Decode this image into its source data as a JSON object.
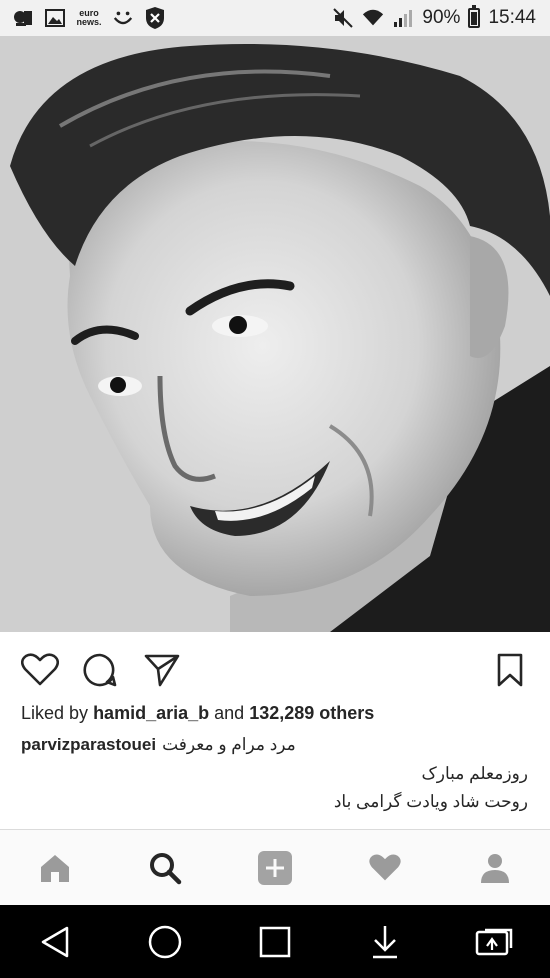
{
  "status_bar": {
    "battery_text": "90%",
    "time": "15:44",
    "battery_level": 0.9,
    "euronews_text": "euro news.",
    "icons": [
      "cloud-notification-icon",
      "gallery-icon",
      "euronews-icon",
      "smiley-icon",
      "shield-icon",
      "mute-icon",
      "wifi-icon",
      "signal-icon",
      "battery-icon"
    ]
  },
  "post": {
    "liked_by_prefix": "Liked by",
    "liked_by_user": "hamid_aria_b",
    "liked_by_and": "and",
    "liked_by_count": "132,289 others",
    "caption_user": "parvizparastouei",
    "caption_line1": "مرد مرام و معرفت",
    "caption_line2": "روزمعلم مبارک",
    "caption_line3": "روحت شاد ویادت گرامی باد"
  },
  "tabbar": {
    "items": [
      "home-icon",
      "search-icon",
      "add-post-icon",
      "activity-heart-icon",
      "profile-icon"
    ],
    "active": "search-icon"
  },
  "navbar": {
    "items": [
      "back-icon",
      "home-circle-icon",
      "recents-icon",
      "download-icon",
      "screen-mirror-icon"
    ]
  }
}
